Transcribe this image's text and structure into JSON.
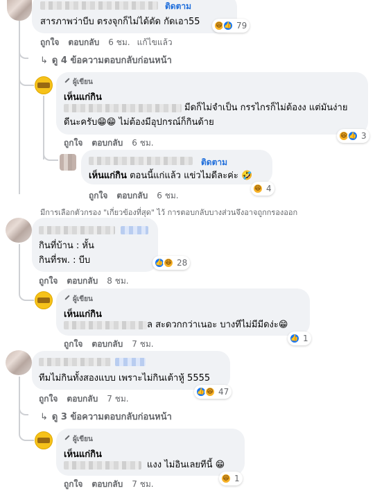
{
  "comments": [
    {
      "follow": "ติดตาม",
      "text": "สารภาพว่าบีบ ตรงจุกก็ไม่ได้ตัด กัดเอา55",
      "reaction_count": "79",
      "reactions": [
        "haha-icon",
        "like-icon"
      ],
      "actions": {
        "like": "ถูกใจ",
        "reply": "ตอบกลับ",
        "time": "6 ชม.",
        "edited": "แก้ไขแล้ว"
      },
      "view_previous": "ดู 4 ข้อความตอบกลับก่อนหน้า",
      "replies": [
        {
          "badge": "ผู้เขียน",
          "name": "เห็นแก่กิน",
          "line1": "มีดก็ไม่จำเป็น กรรไกรก็ไม่ต้องง แต่มันง่าย",
          "line2": "ดีนะครับ😁😁 ไม่ต้องมีอุปกรณ์ก็กินด้าย",
          "reaction_count": "3",
          "actions": {
            "like": "ถูกใจ",
            "reply": "ตอบกลับ",
            "time": "6 ชม."
          }
        },
        {
          "follow": "ติดตาม",
          "mention": "เห็นแก่กิน",
          "text": "ตอนนี้แก่แล้ว แข่วไมดีละค่ะ 🤣",
          "reaction_count": "4",
          "actions": {
            "like": "ถูกใจ",
            "reply": "ตอบกลับ",
            "time": "6 ชม."
          }
        }
      ]
    }
  ],
  "filter_note": "มีการเลือกตัวกรอง \"เกี่ยวข้องที่สุด\" ไว้ การตอบกลับบางส่วนจึงอาจถูกกรองออก",
  "comment2": {
    "line1": "กินที่บ้าน : หั้น",
    "line2": "กินที่รพ. : บีบ",
    "reaction_count": "28",
    "actions": {
      "like": "ถูกใจ",
      "reply": "ตอบกลับ",
      "time": "8 ชม."
    },
    "reply": {
      "badge": "ผู้เขียน",
      "name": "เห็นแก่กิน",
      "text": "ล สะดวกกว่าเนอะ บางทีไม่มีมีดง่ะ😁",
      "reaction_count": "1",
      "actions": {
        "like": "ถูกใจ",
        "reply": "ตอบกลับ",
        "time": "7 ชม."
      }
    }
  },
  "comment3": {
    "text": "ทีมไม่กินทั้งสองแบบ เพราะไม่กินเต้าหู้ 5555",
    "reaction_count": "47",
    "actions": {
      "like": "ถูกใจ",
      "reply": "ตอบกลับ",
      "time": "7 ชม."
    },
    "view_previous": "ดู 3 ข้อความตอบกลับก่อนหน้า",
    "reply": {
      "badge": "ผู้เขียน",
      "name": "เห็นแก่กิน",
      "text": "แงง ไม่อินเลยทีนี้ 😁",
      "reaction_count": "1",
      "actions": {
        "like": "ถูกใจ",
        "reply": "ตอบกลับ",
        "time": "7 ชม."
      }
    }
  },
  "colors": {
    "link": "#216fdb",
    "bubble": "#f0f2f5",
    "muted": "#65676b",
    "like": "#1877f2",
    "haha": "#f7b125"
  }
}
